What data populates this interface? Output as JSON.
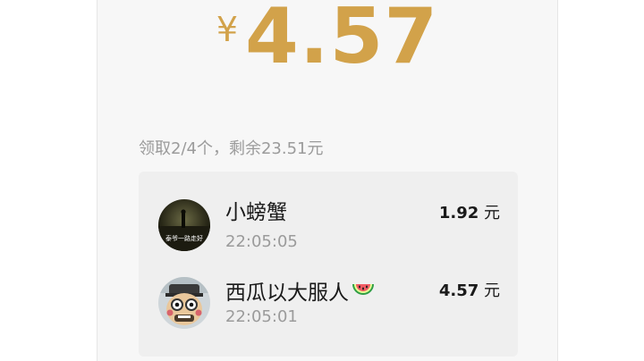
{
  "header": {
    "currency_symbol": "¥",
    "amount": "4.57"
  },
  "status": {
    "text": "领取2/4个，剩余23.51元"
  },
  "receivers": [
    {
      "name": "小螃蟹",
      "time": "22:05:05",
      "amount": "1.92",
      "unit": "元",
      "avatar_caption": "泰爷一路走好"
    },
    {
      "name": "西瓜以大服人",
      "time": "22:05:01",
      "amount": "4.57",
      "unit": "元",
      "name_icon": "watermelon-icon"
    }
  ],
  "colors": {
    "accent_gold": "#d2a24a",
    "panel": "#efefef",
    "muted_text": "#9b9b9b"
  }
}
